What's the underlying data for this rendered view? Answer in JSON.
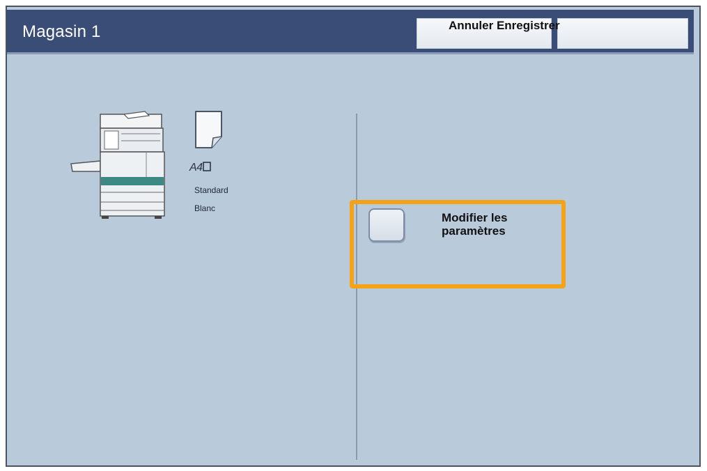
{
  "header": {
    "title": "Magasin 1",
    "buttons_text": "Annuler Enregistrer"
  },
  "tray": {
    "paper_size": "A4",
    "paper_type": "Standard",
    "paper_color": "Blanc"
  },
  "settings": {
    "modify_label": "Modifier les paramètres"
  },
  "icons": [
    "copier-machine-icon",
    "paper-sheet-icon",
    "paper-orientation-icon"
  ],
  "colors": {
    "titlebar": "#3a4d76",
    "panel": "#b9cadb",
    "highlight": "#f5a316",
    "machine_stripe": "#3d8a84"
  }
}
